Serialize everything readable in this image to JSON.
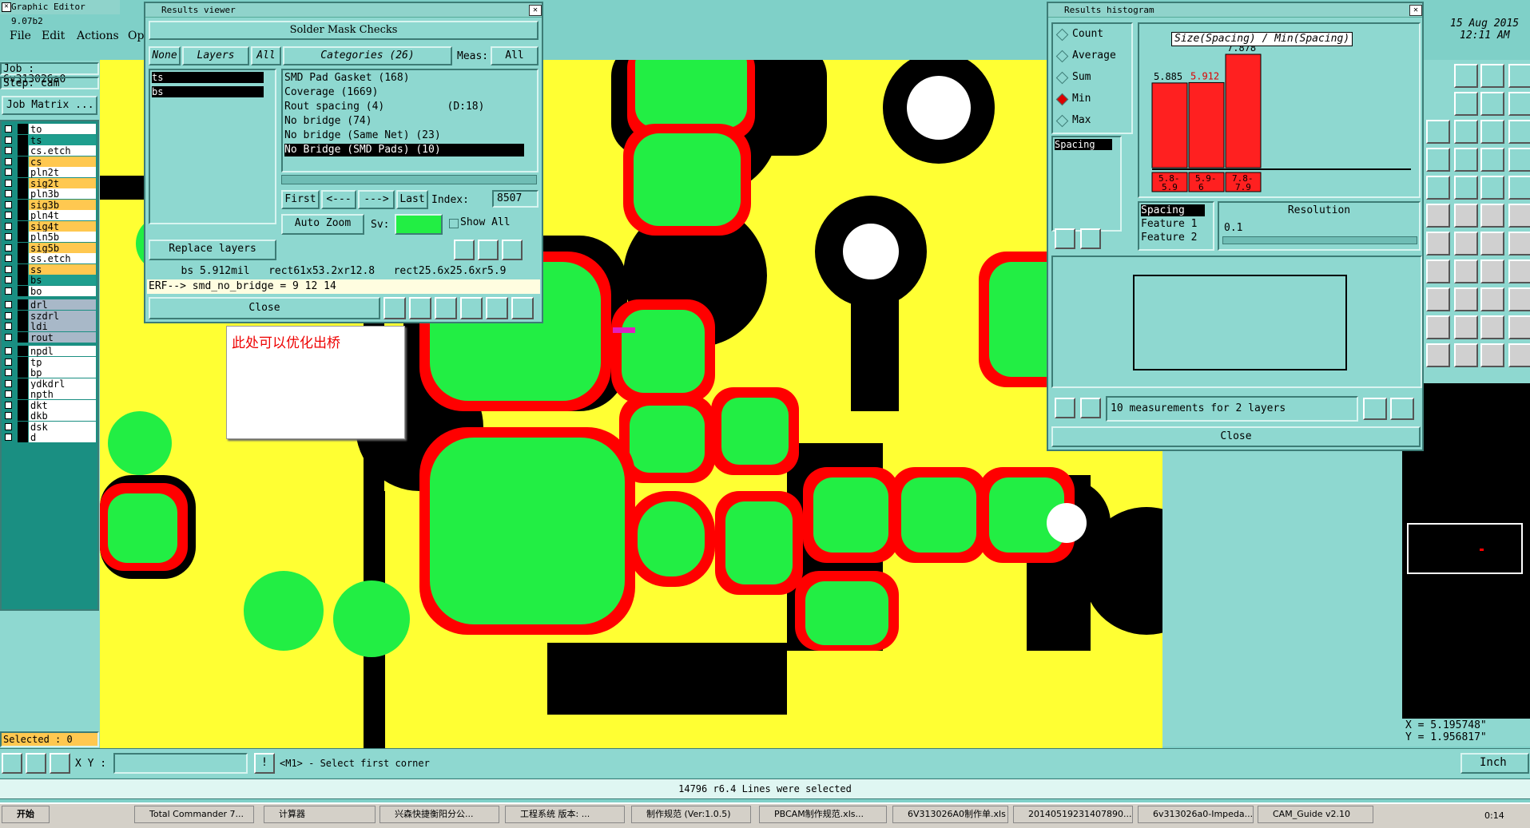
{
  "main_window": {
    "title": "Graphic Editor 9.07b2",
    "menu": [
      "File",
      "Edit",
      "Actions",
      "Op"
    ],
    "job_label": "Job : 6v313026a0",
    "step_label": "Step: cam",
    "job_matrix_button": "Job Matrix ...",
    "selected_label": "Selected : 0",
    "xy_label": "X Y :",
    "prompt": "<M1> - Select first corner",
    "status_message": "14796 r6.4 Lines were selected",
    "coord_x": "X = 5.195748\"",
    "coord_y": "Y = 1.956817\"",
    "units": "Inch",
    "clock_date": "15 Aug 2015",
    "clock_time": "12:11 AM"
  },
  "layers": [
    {
      "name": "to",
      "color": "#ffffff"
    },
    {
      "name": "ts",
      "color": "#1e9e8e"
    },
    {
      "name": "cs.etch",
      "color": "#ffffff"
    },
    {
      "name": "cs",
      "color": "#ffc850"
    },
    {
      "name": "pln2t",
      "color": "#ffffff"
    },
    {
      "name": "sig2t",
      "color": "#ffc850"
    },
    {
      "name": "pln3b",
      "color": "#ffffff"
    },
    {
      "name": "sig3b",
      "color": "#ffc850"
    },
    {
      "name": "pln4t",
      "color": "#ffffff"
    },
    {
      "name": "sig4t",
      "color": "#ffc850"
    },
    {
      "name": "pln5b",
      "color": "#ffffff"
    },
    {
      "name": "sig5b",
      "color": "#ffc850"
    },
    {
      "name": "ss.etch",
      "color": "#ffffff"
    },
    {
      "name": "ss",
      "color": "#ffc850"
    },
    {
      "name": "bs",
      "color": "#1e9e8e"
    },
    {
      "name": "bo",
      "color": "#ffffff"
    },
    {
      "name": "drl",
      "color": "#a8b8c8"
    },
    {
      "name": "szdrl",
      "color": "#a8b8c8"
    },
    {
      "name": "ldi",
      "color": "#a8b8c8"
    },
    {
      "name": "rout",
      "color": "#a8b8c8"
    },
    {
      "name": "npdl",
      "color": "#ffffff"
    },
    {
      "name": "tp",
      "color": "#ffffff"
    },
    {
      "name": "bp",
      "color": "#ffffff"
    },
    {
      "name": "ydkdrl",
      "color": "#ffffff"
    },
    {
      "name": "npth",
      "color": "#ffffff"
    },
    {
      "name": "dkt",
      "color": "#ffffff"
    },
    {
      "name": "dkb",
      "color": "#ffffff"
    },
    {
      "name": "dsk",
      "color": "#ffffff"
    },
    {
      "name": "d",
      "color": "#ffffff"
    }
  ],
  "annotation_note": "此处可以优化出桥",
  "results_viewer": {
    "title": "Results viewer",
    "header": "Solder Mask Checks",
    "filter_none": "None",
    "filter_layers": "Layers",
    "filter_all": "All",
    "categories_label": "Categories (26)",
    "meas_label": "Meas:",
    "meas_value": "All",
    "layers": [
      "ts",
      "bs"
    ],
    "categories": [
      "SMD Pad Gasket (168)",
      "Coverage (1669)",
      "Rout spacing (4)          (D:18)",
      "No bridge (74)",
      "No bridge (Same Net) (23)",
      "No Bridge (SMD Pads) (10)"
    ],
    "first": "First",
    "prev": "<---",
    "next": "--->",
    "last": "Last",
    "index_label": "Index:",
    "index_value": "8507",
    "auto_zoom": "Auto Zoom",
    "sv_label": "Sv:",
    "show_all": "Show All",
    "replace_layers": "Replace layers",
    "info_line": "bs 5.912mil   rect61x53.2xr12.8   rect25.6x25.6xr5.9",
    "erf_line": "ERF--> smd_no_bridge = 9 12 14",
    "close": "Close"
  },
  "results_histogram": {
    "title": "Results histogram",
    "options": [
      "Count",
      "Average",
      "Sum",
      "Min",
      "Max"
    ],
    "selected_option": "Min",
    "list_item": "Spacing",
    "chart_title": "Size(Spacing) / Min(Spacing)",
    "spacing_list": [
      "Spacing",
      "Feature 1",
      "Feature 2"
    ],
    "resolution_label": "Resolution",
    "resolution_value": "0.1",
    "measurements": "10 measurements for 2 layers",
    "close": "Close"
  },
  "chart_data": {
    "type": "bar",
    "title": "Size(Spacing) / Min(Spacing)",
    "categories": [
      "5.8-5.9",
      "5.9-6",
      "7.8-7.9"
    ],
    "values": [
      5.885,
      5.912,
      7.878
    ],
    "highlighted": "5.912",
    "bar_color": "#ff2020",
    "xlabel": "",
    "ylabel": ""
  },
  "taskbar": {
    "start": "开始",
    "items": [
      "Total Commander 7...",
      "计算器",
      "兴森快捷衡阳分公...",
      "工程系统  版本: ...",
      "制作规范 (Ver:1.0.5)",
      "PBCAM制作规范.xls...",
      "6V313026A0制作单.xls",
      "20140519231407890...",
      "6v313026a0-Impeda...",
      "CAM_Guide v2.10"
    ],
    "clock": "0:14"
  },
  "colors": {
    "panel": "#8ed8d0",
    "canvas_bg": "#ffff33",
    "mask": "#000000",
    "pad_outline": "#ff0000",
    "pad_fill": "#22ee44"
  }
}
